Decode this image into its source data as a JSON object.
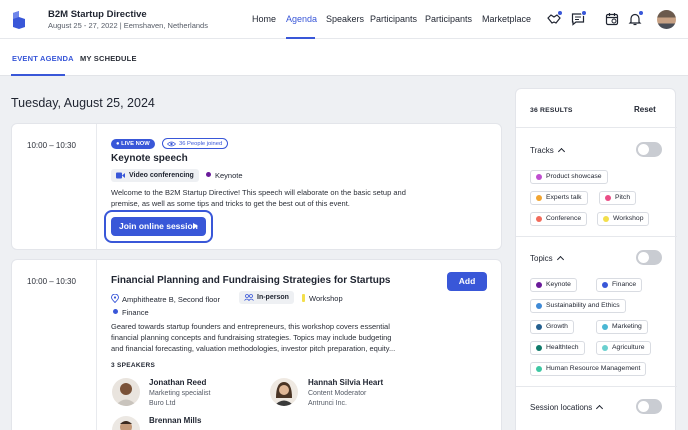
{
  "header": {
    "title": "B2M Startup Directive",
    "subtitle": "August 25 - 27, 2022  |  Eemshaven, Netherlands",
    "nav": [
      "Home",
      "Agenda",
      "Speakers",
      "Participants",
      "Participants",
      "Marketplace"
    ],
    "active_nav": "Agenda"
  },
  "subnav": {
    "tabs": [
      "EVENT AGENDA",
      "MY SCHEDULE"
    ],
    "active": "EVENT AGENDA"
  },
  "date_heading": "Tuesday, August 25, 2024",
  "sessions": [
    {
      "time": "10:00 – 10:30",
      "live_label": "● LIVE NOW",
      "joined_label": "36 People joined",
      "title": "Keynote speech",
      "format": "Video conferencing",
      "track": "Keynote",
      "description_line1": "Welcome to the B2M Startup Directive! This speech will elaborate on the basic setup and",
      "description_line2": "premise, as well as some tips and tricks to get the best out of this event.",
      "action": "Join online session"
    },
    {
      "time": "10:00 – 10:30",
      "title": "Financial Planning and Fundraising Strategies for Startups",
      "location": "Amphitheatre B, Second floor",
      "format": "In-person",
      "type": "Workshop",
      "topic": "Finance",
      "action": "Add",
      "description_line1": "Geared towards startup founders and entrepreneurs, this workshop covers essential",
      "description_line2": "financial planning concepts and fundraising strategies. Topics may include budgeting",
      "description_line3": "and financial forecasting, valuation methodologies, investor pitch preparation, equity...",
      "speakers_label": "3 SPEAKERS",
      "speakers": [
        {
          "name": "Jonathan Reed",
          "role": "Marketing specialist",
          "org": "Buro Ltd"
        },
        {
          "name": "Hannah Silvia Heart",
          "role": "Content Moderator",
          "org": "Antrunci Inc."
        },
        {
          "name": "Brennan Mills"
        }
      ]
    }
  ],
  "filters": {
    "results": "36 RESULTS",
    "reset": "Reset",
    "tracks_title": "Tracks",
    "tracks": [
      {
        "label": "Product showcase",
        "color": "#c04fd0"
      },
      {
        "label": "Experts talk",
        "color": "#f2a531"
      },
      {
        "label": "Pitch",
        "color": "#ea4d86"
      },
      {
        "label": "Conference",
        "color": "#f26b5b"
      },
      {
        "label": "Workshop",
        "color": "#f3df4b"
      }
    ],
    "topics_title": "Topics",
    "topics": [
      {
        "label": "Keynote",
        "color": "#6a1b9a"
      },
      {
        "label": "Finance",
        "color": "#3957d8"
      },
      {
        "label": "Sustainability and Ethics",
        "color": "#3f8ad6"
      },
      {
        "label": "Growth",
        "color": "#245f8f"
      },
      {
        "label": "Marketing",
        "color": "#4ab7d4"
      },
      {
        "label": "Healthtech",
        "color": "#0f7a6a"
      },
      {
        "label": "Agriculture",
        "color": "#6ad0cf"
      },
      {
        "label": "Human Resource Management",
        "color": "#3ec7a3"
      }
    ],
    "locations_title": "Session locations"
  },
  "colors": {
    "accent": "#3957d8"
  }
}
